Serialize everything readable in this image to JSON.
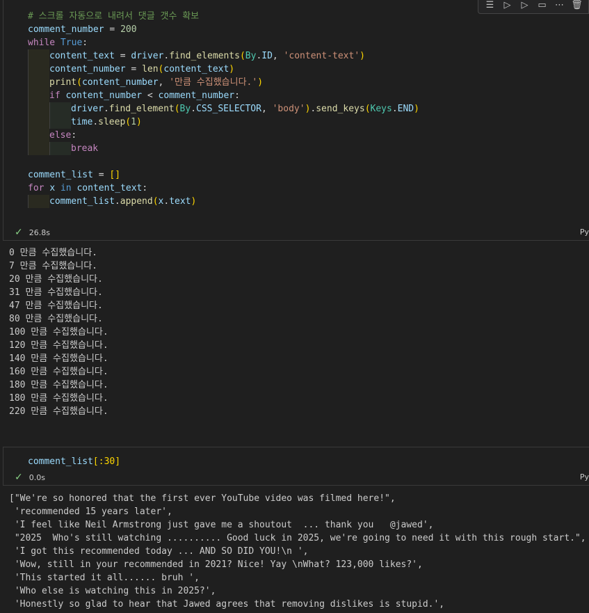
{
  "toolbar": {
    "icons": [
      "run-by-line-icon",
      "execute-above-icon",
      "execute-below-icon",
      "split-cell-icon",
      "more-icon",
      "delete-icon"
    ]
  },
  "cell1": {
    "code": {
      "comment": "# 스크롤 자동으로 내려서 댓글 갯수 확보",
      "l2_var": "comment_number",
      "l2_num": "200",
      "l3_kw": "while",
      "l3_val": "True",
      "l4_var": "content_text",
      "l4_obj": "driver",
      "l4_fn": "find_elements",
      "l4_cls": "By",
      "l4_attr": "ID",
      "l4_str": "'content-text'",
      "l5_var": "content_number",
      "l5_fn": "len",
      "l5_arg": "content_text",
      "l6_fn": "print",
      "l6_arg": "content_number",
      "l6_str": "'만큼 수집했습니다.'",
      "l7_kw": "if",
      "l7_a": "content_number",
      "l7_b": "comment_number",
      "l8_obj": "driver",
      "l8_fn": "find_element",
      "l8_cls": "By",
      "l8_attr": "CSS_SELECTOR",
      "l8_str": "'body'",
      "l8_fn2": "send_keys",
      "l8_cls2": "Keys",
      "l8_attr2": "END",
      "l9_obj": "time",
      "l9_fn": "sleep",
      "l9_num": "1",
      "l10_kw": "else",
      "l11_kw": "break",
      "l13_var": "comment_list",
      "l14_kw": "for",
      "l14_x": "x",
      "l14_in": "in",
      "l14_src": "content_text",
      "l15_obj": "comment_list",
      "l15_fn": "append",
      "l15_x": "x",
      "l15_attr": "text"
    },
    "duration": "26.8s",
    "lang": "Py"
  },
  "output1": [
    "0 만큼 수집했습니다.",
    "7 만큼 수집했습니다.",
    "20 만큼 수집했습니다.",
    "31 만큼 수집했습니다.",
    "47 만큼 수집했습니다.",
    "80 만큼 수집했습니다.",
    "100 만큼 수집했습니다.",
    "120 만큼 수집했습니다.",
    "140 만큼 수집했습니다.",
    "160 만큼 수집했습니다.",
    "180 만큼 수집했습니다.",
    "180 만큼 수집했습니다.",
    "220 만큼 수집했습니다."
  ],
  "cell2": {
    "code_var": "comment_list",
    "code_slice": "[:30]",
    "duration": "0.0s",
    "lang": "Py"
  },
  "output2": [
    "[\"We're so honored that the first ever YouTube video was filmed here!\",",
    " 'recommended 15 years later',",
    " 'I feel like Neil Armstrong just gave me a shoutout  ... thank you   @jawed',",
    " \"2025  Who's still watching .......... Good luck in 2025, we're going to need it with this rough start.\",",
    " 'I got this recommended today ... AND SO DID YOU!\\n ',",
    " 'Wow, still in your recommended in 2021? Nice! Yay \\nWhat? 123,000 likes?',",
    " 'This started it all...... bruh ',",
    " 'Who else is watching this in 2025?',",
    " 'Honestly so glad to hear that Jawed agrees that removing dislikes is stupid.',"
  ]
}
